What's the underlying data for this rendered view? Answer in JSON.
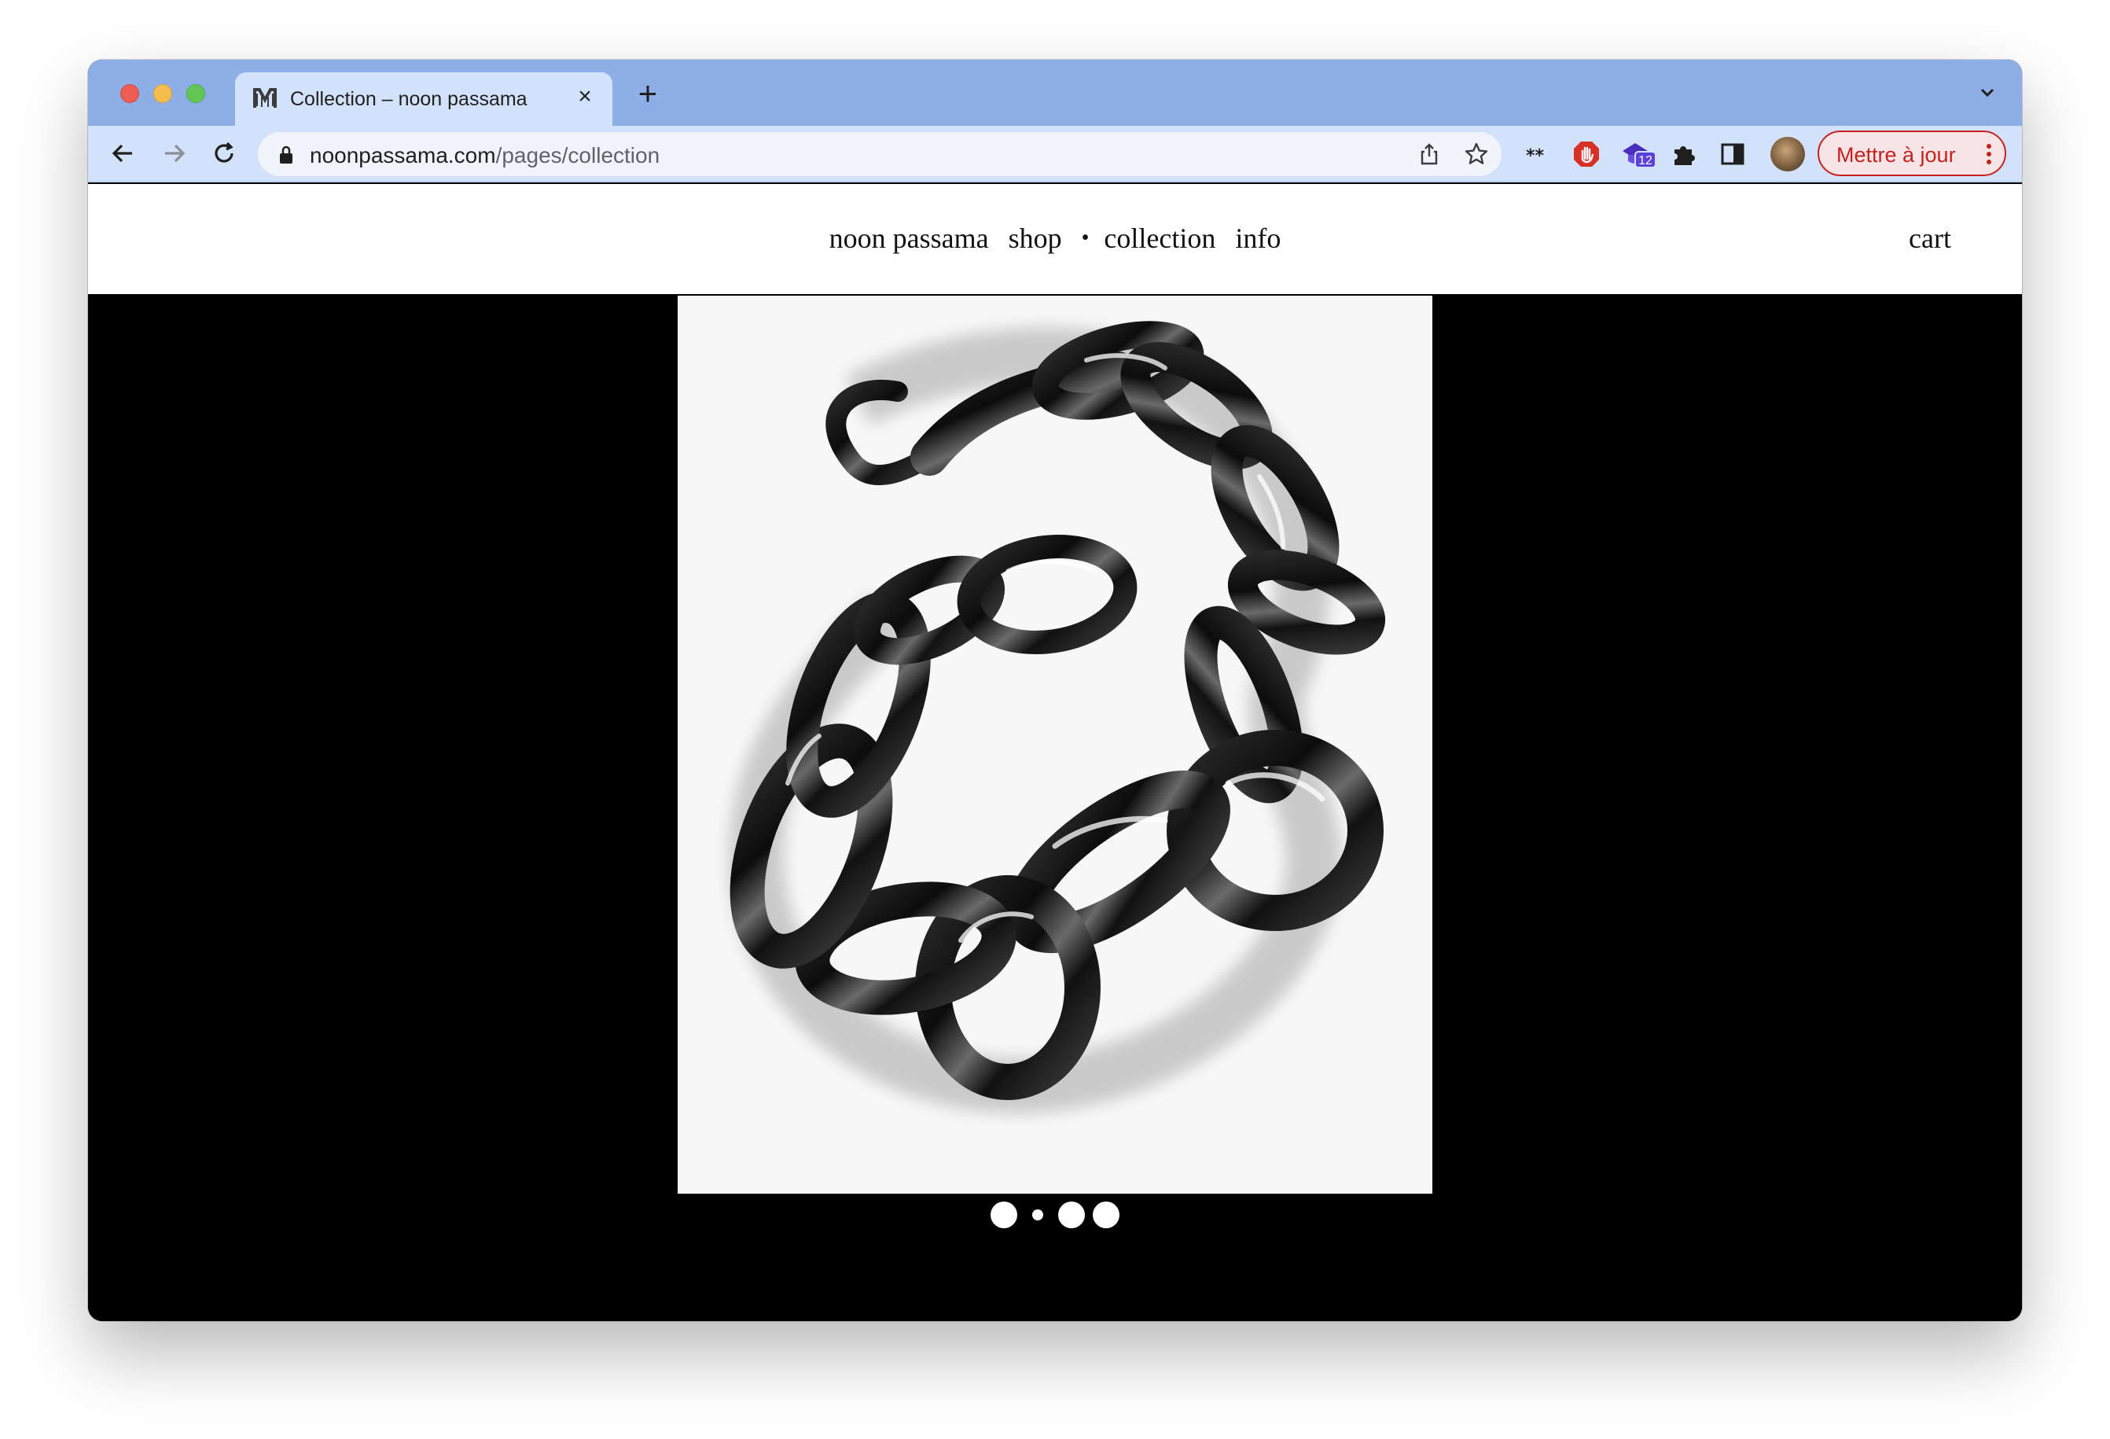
{
  "browser": {
    "tab": {
      "title": "Collection – noon passama",
      "favicon": "noon-passama-logo-icon",
      "close_icon": "×"
    },
    "new_tab_icon": "+",
    "toolbar": {
      "back_icon": "back-arrow-icon",
      "forward_icon": "forward-arrow-icon",
      "reload_icon": "reload-icon"
    },
    "address": {
      "host": "noonpassama.com",
      "path": "/pages/collection"
    },
    "extensions": {
      "puzzle_badge_count": "12"
    },
    "update_button": {
      "label": "Mettre à jour"
    }
  },
  "site": {
    "nav": {
      "brand": "noon passama",
      "shop": "shop",
      "bullet": "•",
      "collection": "collection",
      "info": "info"
    },
    "cart": "cart"
  },
  "gallery": {
    "image_subject": "chrome chain bracelet",
    "dots": [
      "inactive",
      "active",
      "inactive",
      "inactive"
    ],
    "colors": {
      "stage_background": "#000000",
      "image_background": "#f7f7f7",
      "dot": "#ffffff"
    }
  },
  "colors": {
    "tab_strip": "#8eaee8",
    "toolbar": "#d3e2fb",
    "update_accent": "#c5221f"
  }
}
